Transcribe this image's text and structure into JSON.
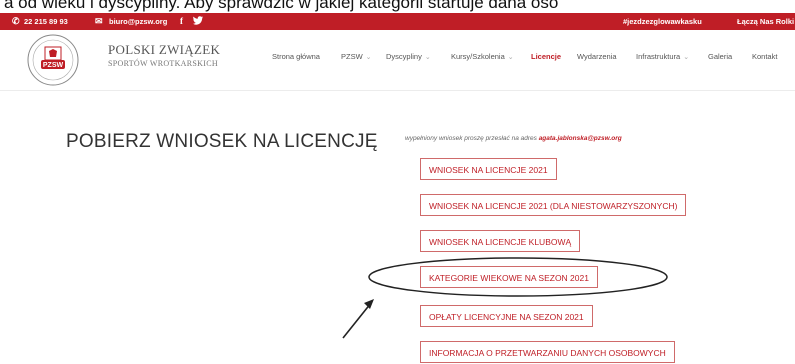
{
  "caption": "a od wieku i dyscypliny. Aby sprawdzić w jakiej kategorii startuje dana oso",
  "topbar": {
    "phone": "22 215 89 93",
    "email": "biuro@pzsw.org",
    "hashtag": "#jezdzezglowawkasku",
    "link": "Łączą Nas Rolki",
    "icons": [
      "phone-icon",
      "mail-icon",
      "facebook-icon",
      "twitter-icon"
    ]
  },
  "header": {
    "brand_line1": "POLSKI ZWIĄZEK",
    "brand_line2": "SPORTÓW WROTKARSKICH",
    "logo_text": "PZSW",
    "accent": "#bf1e26"
  },
  "nav": [
    {
      "label": "Strona główna",
      "dropdown": false
    },
    {
      "label": "PZSW",
      "dropdown": true
    },
    {
      "label": "Dyscypliny",
      "dropdown": true
    },
    {
      "label": "Kursy/Szkolenia",
      "dropdown": true
    },
    {
      "label": "Licencje",
      "dropdown": false,
      "active": true
    },
    {
      "label": "Wydarzenia",
      "dropdown": false
    },
    {
      "label": "Infrastruktura",
      "dropdown": true
    },
    {
      "label": "Galeria",
      "dropdown": false
    },
    {
      "label": "Kontakt",
      "dropdown": false
    }
  ],
  "main": {
    "title": "POBIERZ WNIOSEK NA LICENCJĘ",
    "note_prefix": "wypełniony wniosek proszę przesłać na adres",
    "note_email": "agata.jablonska@pzsw.org",
    "buttons": [
      "WNIOSEK NA LICENCJE 2021",
      "WNIOSEK NA LICENCJE 2021 (DLA NIESTOWARZYSZONYCH)",
      "WNIOSEK NA LICENCJE KLUBOWĄ",
      "KATEGORIE WIEKOWE NA SEZON 2021",
      "OPŁATY LICENCYJNE NA SEZON 2021",
      "INFORMACJA O PRZETWARZANIU DANYCH OSOBOWYCH"
    ]
  }
}
